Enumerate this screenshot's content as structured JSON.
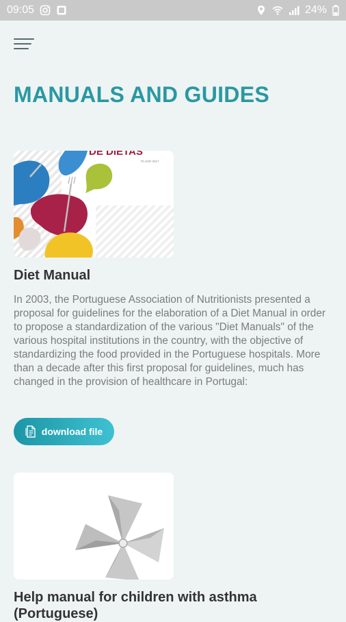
{
  "status_bar": {
    "time": "09:05",
    "battery": "24%",
    "left_icons": [
      "instagram-icon",
      "photo-icon"
    ],
    "right_icons": [
      "location-icon",
      "wifi-icon",
      "signal-icon",
      "battery-icon"
    ]
  },
  "header": {
    "menu_icon": "hamburger-menu-icon"
  },
  "page": {
    "title": "MANUALS AND GUIDES"
  },
  "manuals": [
    {
      "image_text": "DE DIETAS",
      "title": "Diet Manual",
      "description": "In 2003, the Portuguese Association of Nutritionists presented a proposal for guidelines for the elaboration of a Diet Manual in order to propose a standardization of the various \"Diet Manuals\" of the various hospital institutions in the country, with the objective of standardizing the food provided in the Portuguese hospitals. More than a decade after this first proposal for guidelines, much has changed in the provision of healthcare in Portugal:",
      "download_label": "download file",
      "download_icon": "file-icon"
    },
    {
      "title": "Help manual for children with asthma (Portuguese)"
    }
  ],
  "colors": {
    "accent": "#2a98a3",
    "button_start": "#1c96a6",
    "button_end": "#3fc1d1"
  }
}
